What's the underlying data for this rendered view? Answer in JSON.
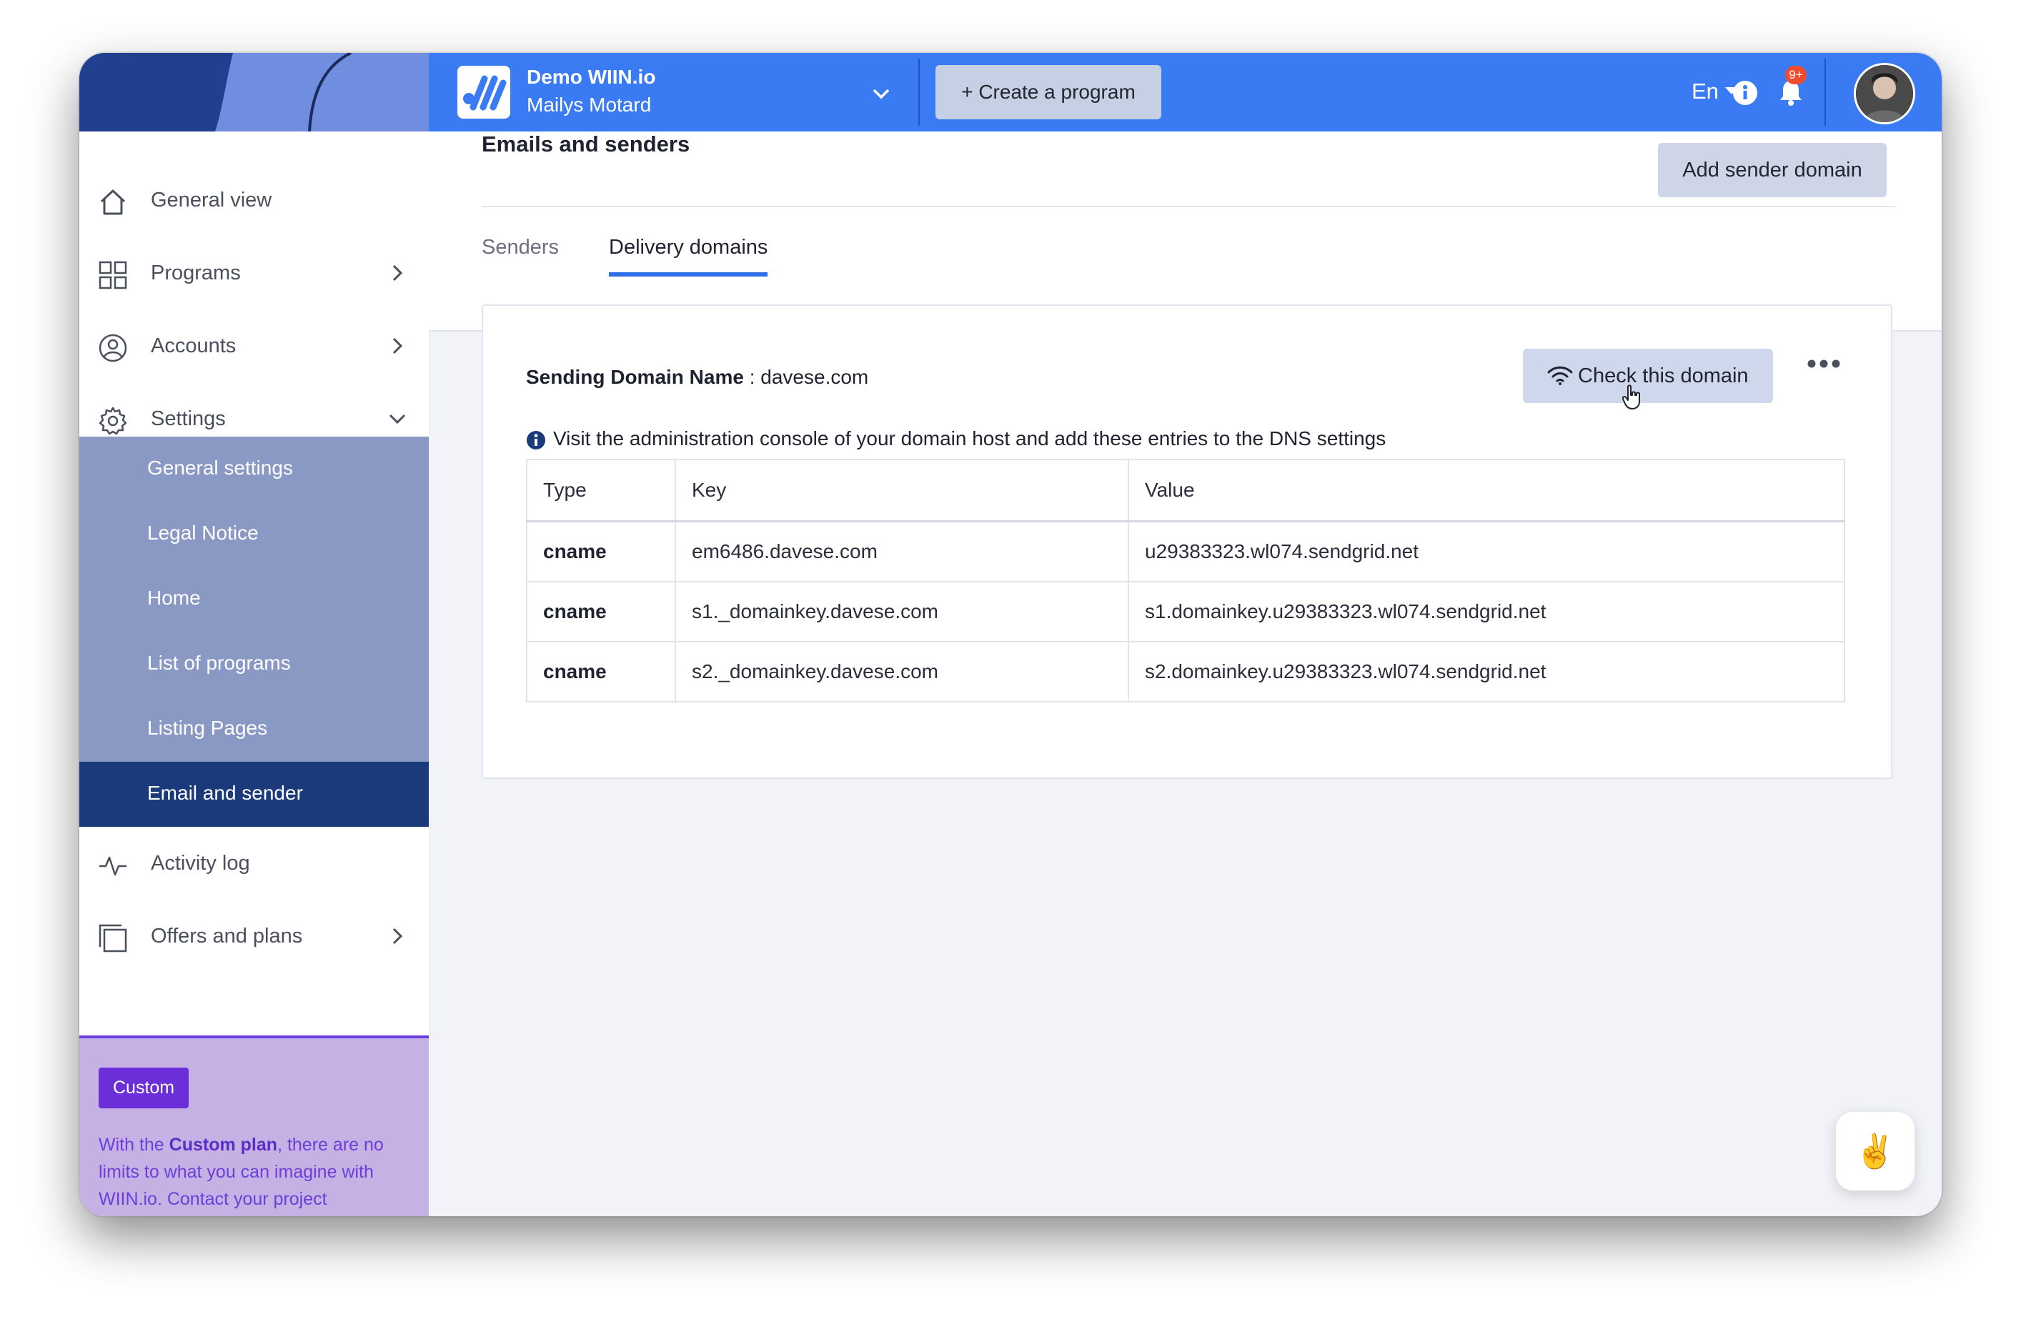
{
  "org": {
    "name": "Demo WIIN.io",
    "user": "Mailys Motard"
  },
  "topbar": {
    "create_label": "+ Create a program",
    "lang": "En",
    "notif_count": "9+"
  },
  "sidebar": {
    "items": [
      {
        "label": "General view"
      },
      {
        "label": "Programs"
      },
      {
        "label": "Accounts"
      },
      {
        "label": "Settings"
      },
      {
        "label": "Activity log"
      },
      {
        "label": "Offers and plans"
      }
    ],
    "settings_sub": [
      {
        "label": "General settings"
      },
      {
        "label": "Legal Notice"
      },
      {
        "label": "Home"
      },
      {
        "label": "List of programs"
      },
      {
        "label": "Listing Pages"
      },
      {
        "label": "Email and sender"
      }
    ],
    "plan": {
      "badge": "Custom",
      "text_prefix": "With the ",
      "text_bold": "Custom plan",
      "text_suffix": ", there are no limits to what you can imagine with WIIN.io. Contact your project"
    }
  },
  "page": {
    "title": "Emails and senders",
    "add_button": "Add sender domain",
    "tabs": [
      "Senders",
      "Delivery domains"
    ],
    "active_tab": "Delivery domains"
  },
  "domain": {
    "label": "Sending Domain Name",
    "separator": " : ",
    "name": "davese.com",
    "check_button": "Check this domain",
    "notice": "Visit the administration console of your domain host and add these entries to the DNS settings"
  },
  "dns_table": {
    "headers": [
      "Type",
      "Key",
      "Value"
    ],
    "rows": [
      {
        "type": "cname",
        "key": "em6486.davese.com",
        "value": "u29383323.wl074.sendgrid.net"
      },
      {
        "type": "cname",
        "key": "s1._domainkey.davese.com",
        "value": "s1.domainkey.u29383323.wl074.sendgrid.net"
      },
      {
        "type": "cname",
        "key": "s2._domainkey.davese.com",
        "value": "s2.domainkey.u29383323.wl074.sendgrid.net"
      }
    ]
  },
  "chat_emoji": "✌️",
  "colors": {
    "topbar": "#3a7bf4",
    "sidebar_active": "#1b3a7c",
    "sidebar_sub": "#8a98c4",
    "plan_bg": "#c5b1e4",
    "plan_badge": "#6a2fd8",
    "tab_accent": "#2f6ee8"
  }
}
